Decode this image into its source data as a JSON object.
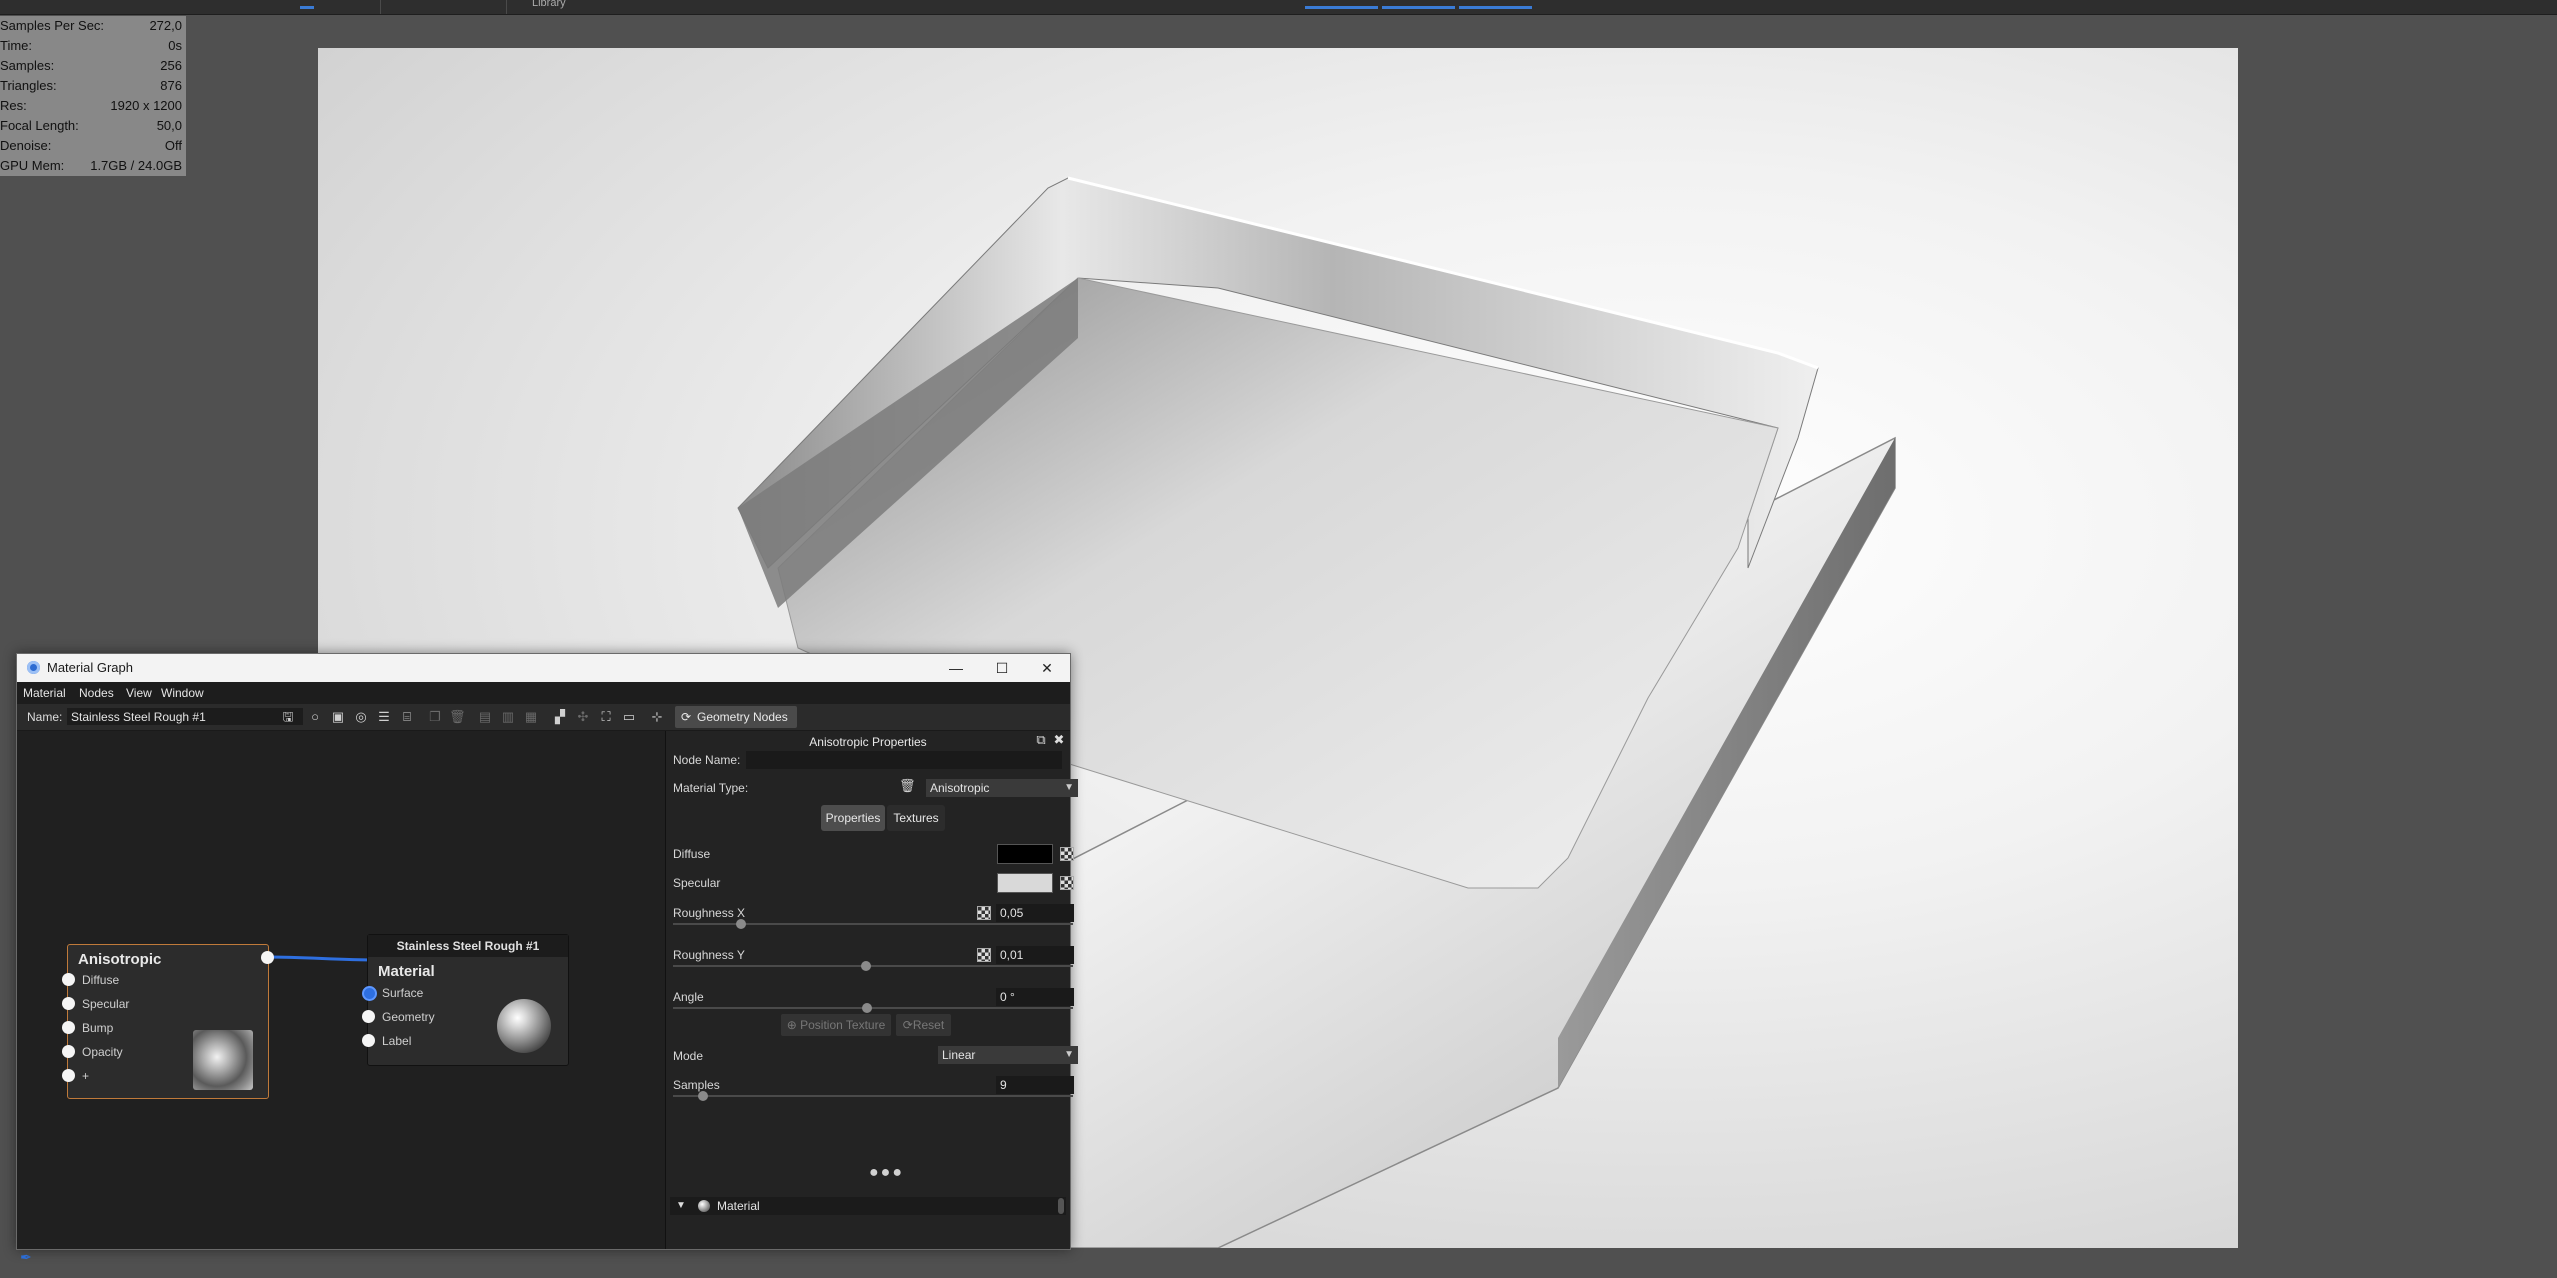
{
  "topbar": {
    "text": "Library",
    "colors": {
      "indicator": "#3a7bd5"
    }
  },
  "stats": [
    {
      "key": "Samples Per Sec:",
      "value": "272,0"
    },
    {
      "key": "Time:",
      "value": "0s"
    },
    {
      "key": "Samples:",
      "value": "256"
    },
    {
      "key": "Triangles:",
      "value": "876"
    },
    {
      "key": "Res:",
      "value": "1920 x 1200"
    },
    {
      "key": "Focal Length:",
      "value": "50,0"
    },
    {
      "key": "Denoise:",
      "value": "Off"
    },
    {
      "key": "GPU Mem:",
      "value": "1.7GB / 24.0GB"
    }
  ],
  "window": {
    "title": "Material Graph",
    "controls": {
      "minimize": "—",
      "maximize": "☐",
      "close": "✕"
    }
  },
  "menu": [
    "Material",
    "Nodes",
    "View",
    "Window"
  ],
  "toolbar": {
    "name_label": "Name:",
    "name_value": "Stainless Steel Rough #1",
    "geometry_nodes_label": "Geometry Nodes",
    "icons": [
      "save-icon",
      "sphere-preview-icon",
      "texture-icon",
      "target-icon",
      "sliders-icon",
      "grid-icon",
      "duplicate-icon",
      "delete-icon",
      "add-node-icon",
      "remove-node-icon",
      "link-icon",
      "layout-icon",
      "align-icon",
      "frame-icon",
      "fit-icon",
      "connect-icon",
      "refresh-icon"
    ]
  },
  "graph": {
    "aniso_node": {
      "title": "Anisotropic",
      "inputs": [
        "Diffuse",
        "Specular",
        "Bump",
        "Opacity",
        "+"
      ],
      "border_color": "#c07a3a"
    },
    "material_node": {
      "header": "Stainless Steel Rough #1",
      "title": "Material",
      "inputs": [
        "Surface",
        "Geometry",
        "Label"
      ]
    },
    "link_color": "#2e6fe0"
  },
  "panel": {
    "title": "Anisotropic Properties",
    "node_name_label": "Node Name:",
    "node_name_value": "",
    "material_type_label": "Material Type:",
    "material_type_value": "Anisotropic",
    "tabs": [
      "Properties",
      "Textures"
    ],
    "active_tab": "Properties",
    "diffuse_label": "Diffuse",
    "diffuse_color": "#000000",
    "specular_label": "Specular",
    "specular_color": "#d9d9d9",
    "roughness_x_label": "Roughness X",
    "roughness_x_value": "0,05",
    "roughness_y_label": "Roughness Y",
    "roughness_y_value": "0,01",
    "angle_label": "Angle",
    "angle_value": "0 °",
    "position_texture_label": "Position Texture",
    "reset_label": "Reset",
    "mode_label": "Mode",
    "mode_value": "Linear",
    "samples_label": "Samples",
    "samples_value": "9",
    "dots": "●●●",
    "material_section": "Material"
  }
}
